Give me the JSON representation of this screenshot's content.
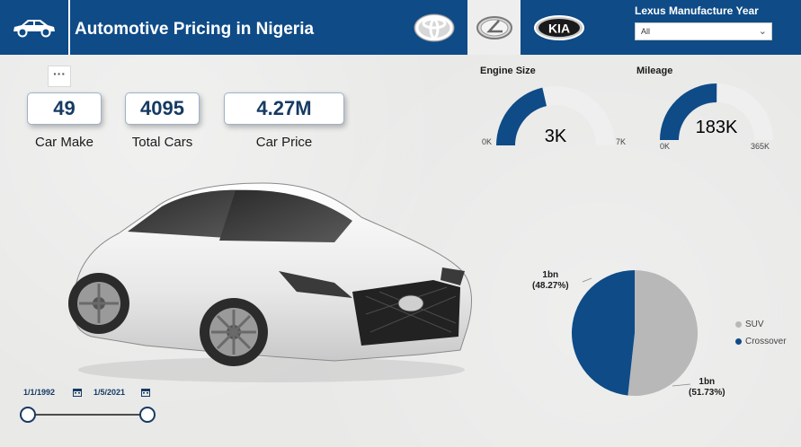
{
  "header": {
    "title": "Automotive Pricing in Nigeria",
    "filter_label": "Lexus Manufacture Year",
    "filter_value": "All",
    "brands": [
      "toyota-logo",
      "lexus-logo",
      "kia-logo"
    ],
    "kia_text": "KIA",
    "color": "#0e4b87"
  },
  "kpis": [
    {
      "value": "49",
      "label": "Car Make"
    },
    {
      "value": "4095",
      "label": "Total Cars"
    },
    {
      "value": "4.27M",
      "label": "Car Price"
    }
  ],
  "more_options": "···",
  "gauges": {
    "engine_size": {
      "title": "Engine Size",
      "value_label": "3K",
      "min_label": "0K",
      "max_label": "7K",
      "value": 3,
      "min": 0,
      "max": 7
    },
    "mileage": {
      "title": "Mileage",
      "value_label": "183K",
      "min_label": "0K",
      "max_label": "365K",
      "value": 183,
      "min": 0,
      "max": 365
    }
  },
  "date_slicer": {
    "start": "1/1/1992",
    "end": "1/5/2021"
  },
  "chart_data": {
    "type": "pie",
    "series": [
      {
        "name": "SUV",
        "value": 51.73,
        "label": "1bn",
        "percent_label": "(51.73%)",
        "color": "#b8b8b8"
      },
      {
        "name": "Crossover",
        "value": 48.27,
        "label": "1bn",
        "percent_label": "(48.27%)",
        "color": "#0e4b87"
      }
    ],
    "legend_position": "right"
  },
  "colors": {
    "accent": "#0e4b87",
    "gauge_empty": "#efefef",
    "kpi_text": "#163a63"
  }
}
